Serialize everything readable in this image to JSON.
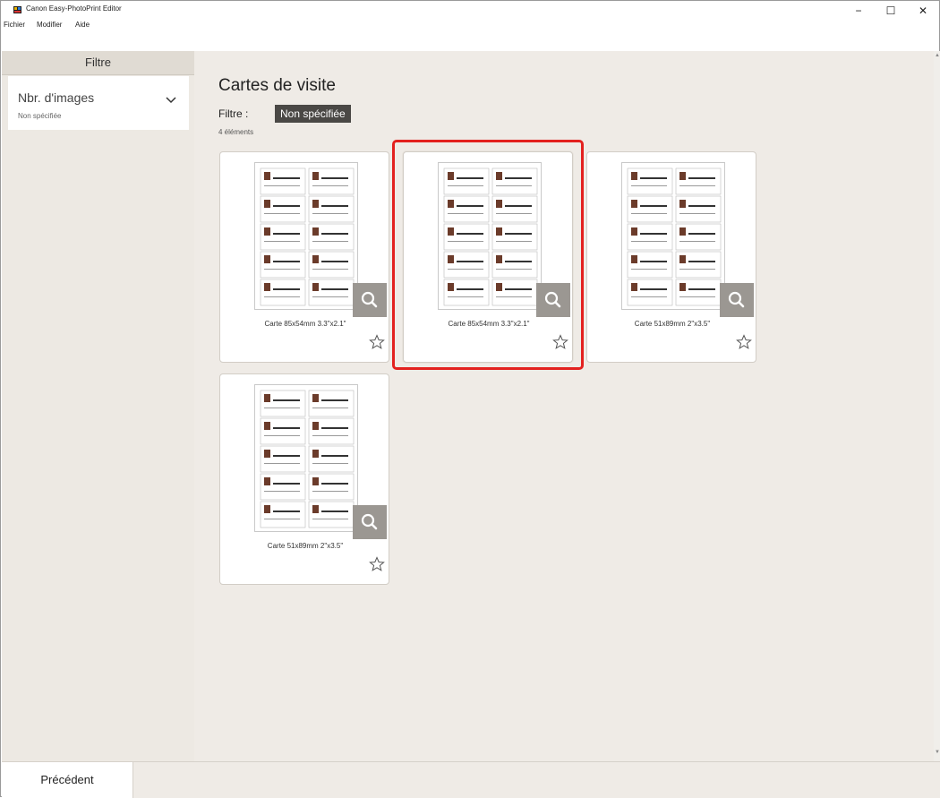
{
  "window": {
    "title": "Canon Easy-PhotoPrint Editor",
    "minimize": "−",
    "maximize": "☐",
    "close": "✕"
  },
  "menu": [
    "Fichier",
    "Modifier",
    "Aide"
  ],
  "sidebar": {
    "header": "Filtre",
    "filter": {
      "title": "Nbr. d'images",
      "value": "Non spécifiée",
      "icon": "chevron-down-icon"
    }
  },
  "main": {
    "title": "Cartes de visite",
    "filter_label": "Filtre :",
    "filter_value": "Non spécifiée",
    "count": "4 éléments"
  },
  "templates": [
    {
      "label": "Carte 85x54mm 3.3\"x2.1\"",
      "selected": false
    },
    {
      "label": "Carte 85x54mm 3.3\"x2.1\"",
      "selected": true
    },
    {
      "label": "Carte 51x89mm 2\"x3.5\"",
      "selected": false
    },
    {
      "label": "Carte 51x89mm 2\"x3.5\"",
      "selected": false
    }
  ],
  "footer": {
    "back_label": "Précédent"
  },
  "colors": {
    "accent_selection": "#e3211f",
    "sidebar_bg": "#ede9e3",
    "main_bg": "#efebe6",
    "badge_bg": "#4a4845"
  }
}
